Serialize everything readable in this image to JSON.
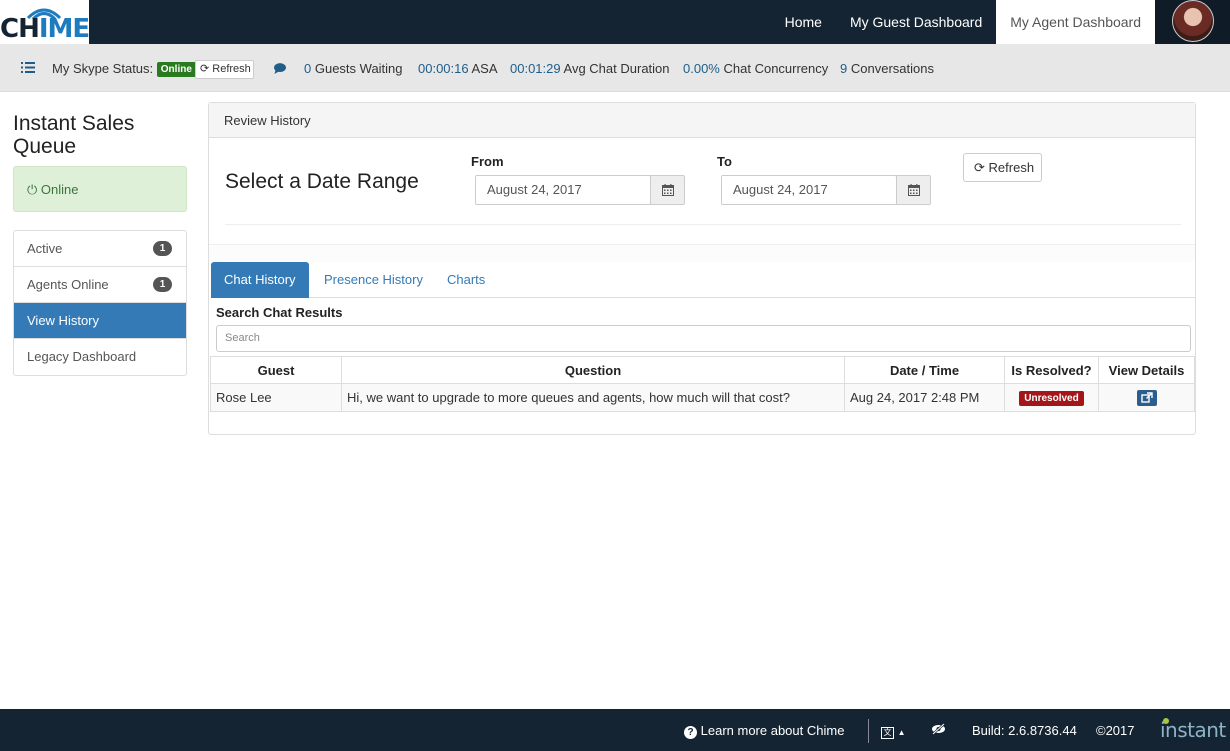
{
  "brand": {
    "logo_text_ch": "CH",
    "logo_text_ime": "IME",
    "footer_logo": "instant"
  },
  "nav": {
    "links": [
      "Home",
      "My Guest Dashboard",
      "My Agent Dashboard"
    ],
    "active": 2
  },
  "status_bar": {
    "skype_label": "My Skype Status:",
    "skype_status": "Online",
    "refresh_label": "Refresh",
    "guests_waiting_value": "0",
    "guests_waiting_label": "Guests Waiting",
    "asa_value": "00:00:16",
    "asa_label": "ASA",
    "avg_chat_value": "00:01:29",
    "avg_chat_label": "Avg Chat Duration",
    "concurrency_value": "0.00%",
    "concurrency_label": "Chat Concurrency",
    "conversations_value": "9",
    "conversations_label": "Conversations"
  },
  "sidebar": {
    "queue_title": "Instant Sales Queue",
    "status": "Online",
    "items": [
      {
        "label": "Active",
        "badge": "1"
      },
      {
        "label": "Agents Online",
        "badge": "1"
      },
      {
        "label": "View History",
        "badge": ""
      },
      {
        "label": "Legacy Dashboard",
        "badge": ""
      }
    ],
    "active_index": 2
  },
  "review": {
    "panel_title": "Review History",
    "range_title": "Select a Date Range",
    "from_label": "From",
    "from_value": "August 24, 2017",
    "to_label": "To",
    "to_value": "August 24, 2017",
    "refresh_label": "Refresh"
  },
  "tabs": [
    "Chat History",
    "Presence History",
    "Charts"
  ],
  "search": {
    "label": "Search Chat Results",
    "placeholder": "Search"
  },
  "table": {
    "headers": [
      "Guest",
      "Question",
      "Date / Time",
      "Is Resolved?",
      "View Details"
    ],
    "rows": [
      {
        "guest": "Rose Lee",
        "question": "Hi, we want to upgrade to more queues and agents, how much will that cost?",
        "datetime": "Aug 24, 2017 2:48 PM",
        "resolved": "Unresolved"
      }
    ]
  },
  "footer": {
    "learn_more": "Learn more about Chime",
    "build": "Build: 2.6.8736.44",
    "copyright": "©2017"
  },
  "colors": {
    "nav_bg": "#142433",
    "accent": "#337ab7",
    "online": "#2a7a20",
    "unresolved": "#a4151a"
  }
}
